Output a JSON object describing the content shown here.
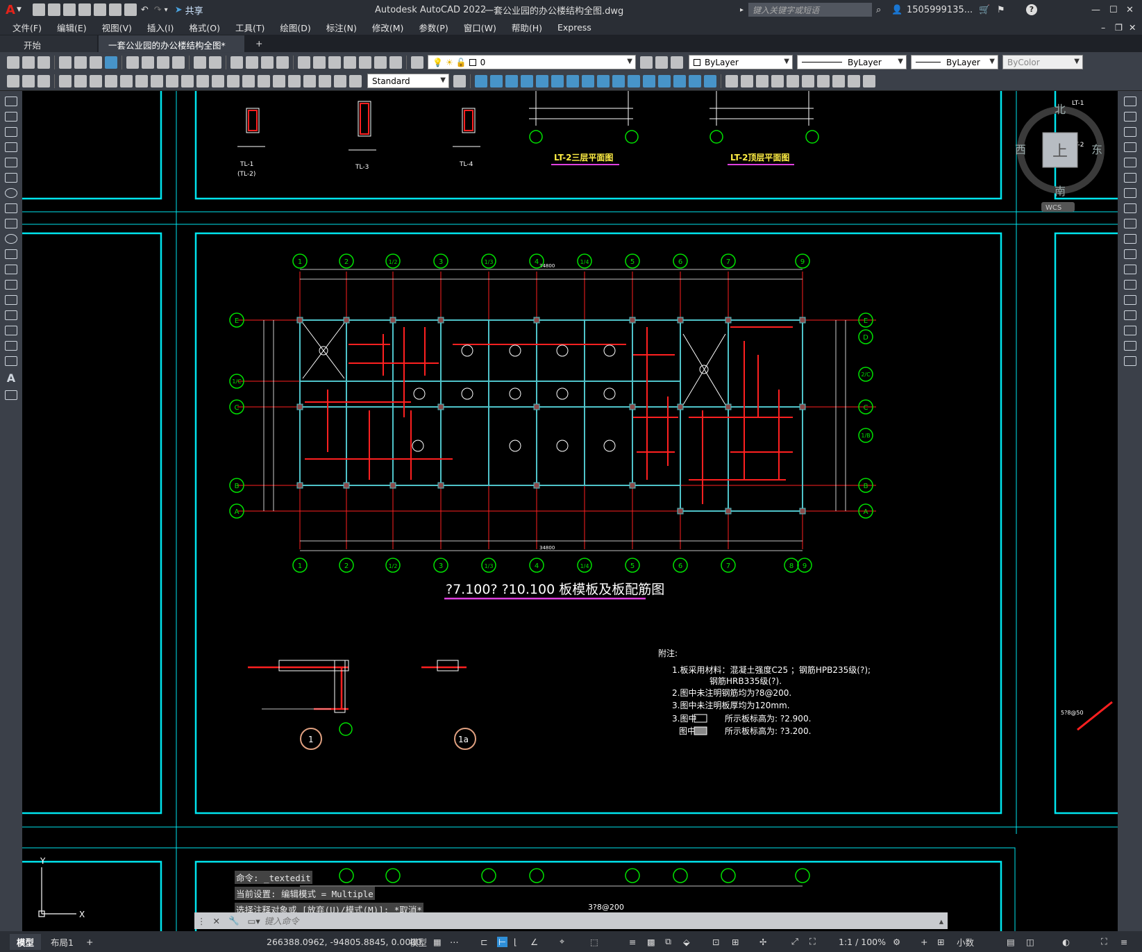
{
  "titlebar": {
    "app_title": "Autodesk AutoCAD 2022",
    "file_title": "一套公业园的办公楼结构全图.dwg",
    "share_label": "共享",
    "search_placeholder": "键入关键字或短语",
    "user_label": "1505999135...",
    "app_logo": "A"
  },
  "menu": {
    "items": [
      "文件(F)",
      "编辑(E)",
      "视图(V)",
      "插入(I)",
      "格式(O)",
      "工具(T)",
      "绘图(D)",
      "标注(N)",
      "修改(M)",
      "参数(P)",
      "窗口(W)",
      "帮助(H)",
      "Express"
    ]
  },
  "tabs": {
    "start": "开始",
    "document": "一套公业园的办公楼结构全图*",
    "add": "+"
  },
  "toolbar": {
    "layer_value": "0",
    "color_value": "ByLayer",
    "linetype_value": "ByLayer",
    "lineweight_value": "ByLayer",
    "plotstyle_value": "ByColor",
    "textstyle_value": "Standard"
  },
  "viewcube": {
    "north": "北",
    "south": "南",
    "east": "东",
    "west": "西",
    "top": "上",
    "wcs": "WCS"
  },
  "drawing": {
    "main_title": "?7.100?  ?10.100  板模板及板配筋图",
    "lt2_third": "LT-2三层平面图",
    "lt2_roof": "LT-2顶层平面图",
    "beam_tl1": "TL-1",
    "beam_tl1b": "(TL-2)",
    "beam_tl3": "TL-3",
    "beam_tl4": "TL-4",
    "grid_top": [
      "1",
      "2",
      "1/2",
      "3",
      "1/3",
      "4",
      "1/4",
      "5",
      "6",
      "7",
      "9"
    ],
    "grid_bottom": [
      "1",
      "2",
      "1/2",
      "3",
      "1/3",
      "4",
      "1/4",
      "5",
      "6",
      "7",
      "8",
      "9"
    ],
    "grid_left": [
      "E",
      "1/C",
      "C",
      "B",
      "A"
    ],
    "grid_right": [
      "E",
      "D",
      "2/C",
      "C",
      "1/B",
      "B",
      "A"
    ],
    "overall_dim": "34800",
    "notes_title": "附注:",
    "notes": [
      "1.板采用材料：混凝土强度C25 ；钢筋HPB235级(?);",
      "钢筋HRB335级(?).",
      "2.图中未注明钢筋均为?8@200.",
      "3.图中未注明板厚均为120mm.",
      "3.图中",
      "所示板标高为: ?2.900.",
      "图中",
      "所示板标高为: ?3.200."
    ],
    "detail1": "1",
    "detail1a": "1a",
    "bottom_label": "3?8@200",
    "side_note1": "LT-1",
    "side_note2": "LT-2",
    "side_label": "5?8@50"
  },
  "command": {
    "history": [
      "命令: _textedit",
      "当前设置: 编辑模式 = Multiple",
      "选择注释对象或 [放弃(U)/模式(M)]: *取消*"
    ],
    "placeholder": "键入命令"
  },
  "status": {
    "layout_model": "模型",
    "layout_1": "布局1",
    "coords": "266388.0962, -94805.8845, 0.0000",
    "model_btn": "模型",
    "scale": "1:1 / 100%",
    "units": "小数"
  },
  "colors": {
    "frame": "#00e5ee",
    "grid_bubble": "#00e000",
    "rebar": "#ff2020",
    "beam": "#4fc3c9",
    "dim_text": "#ffffff",
    "title_underline": "#e040e0"
  }
}
